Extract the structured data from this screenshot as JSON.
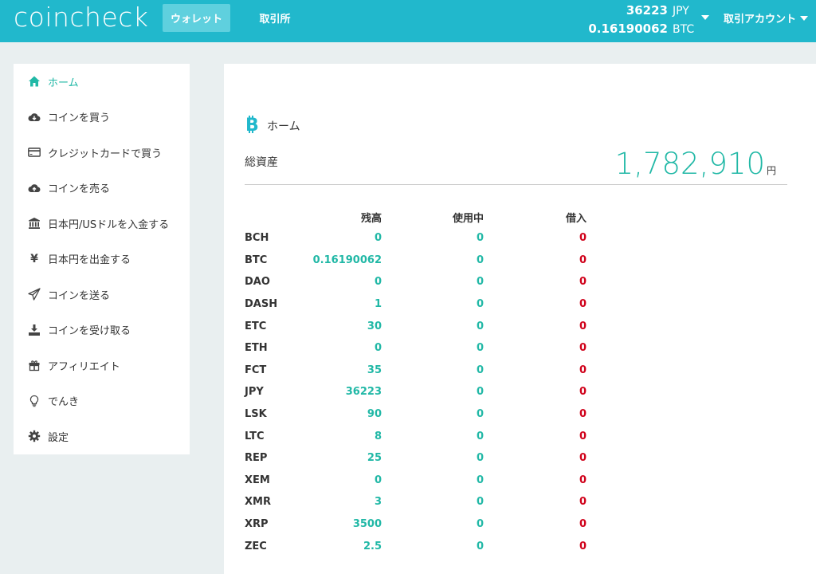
{
  "header": {
    "logo": "coincheck",
    "nav": {
      "wallet": "ウォレット",
      "exchange": "取引所"
    },
    "balance": {
      "jpy_amount": "36223",
      "jpy_unit": "JPY",
      "btc_amount": "0.16190062",
      "btc_unit": "BTC"
    },
    "account": "取引アカウント"
  },
  "sidebar": {
    "items": [
      {
        "label": "ホーム",
        "icon": "home-icon"
      },
      {
        "label": "コインを買う",
        "icon": "cloud-download-icon"
      },
      {
        "label": "クレジットカードで買う",
        "icon": "credit-card-icon"
      },
      {
        "label": "コインを売る",
        "icon": "cloud-upload-icon"
      },
      {
        "label": "日本円/USドルを入金する",
        "icon": "bank-icon"
      },
      {
        "label": "日本円を出金する",
        "icon": "yen-icon"
      },
      {
        "label": "コインを送る",
        "icon": "send-icon"
      },
      {
        "label": "コインを受け取る",
        "icon": "download-icon"
      },
      {
        "label": "アフィリエイト",
        "icon": "gift-icon"
      },
      {
        "label": "でんき",
        "icon": "lightbulb-icon"
      },
      {
        "label": "設定",
        "icon": "gear-icon"
      }
    ]
  },
  "main": {
    "title": "ホーム",
    "total_label": "総資産",
    "total_value": "1,782,910",
    "total_unit": "円",
    "table": {
      "headers": {
        "balance": "残高",
        "in_use": "使用中",
        "borrowed": "借入"
      },
      "rows": [
        {
          "coin": "BCH",
          "balance": "0",
          "in_use": "0",
          "borrowed": "0"
        },
        {
          "coin": "BTC",
          "balance": "0.16190062",
          "in_use": "0",
          "borrowed": "0"
        },
        {
          "coin": "DAO",
          "balance": "0",
          "in_use": "0",
          "borrowed": "0"
        },
        {
          "coin": "DASH",
          "balance": "1",
          "in_use": "0",
          "borrowed": "0"
        },
        {
          "coin": "ETC",
          "balance": "30",
          "in_use": "0",
          "borrowed": "0"
        },
        {
          "coin": "ETH",
          "balance": "0",
          "in_use": "0",
          "borrowed": "0"
        },
        {
          "coin": "FCT",
          "balance": "35",
          "in_use": "0",
          "borrowed": "0"
        },
        {
          "coin": "JPY",
          "balance": "36223",
          "in_use": "0",
          "borrowed": "0"
        },
        {
          "coin": "LSK",
          "balance": "90",
          "in_use": "0",
          "borrowed": "0"
        },
        {
          "coin": "LTC",
          "balance": "8",
          "in_use": "0",
          "borrowed": "0"
        },
        {
          "coin": "REP",
          "balance": "25",
          "in_use": "0",
          "borrowed": "0"
        },
        {
          "coin": "XEM",
          "balance": "0",
          "in_use": "0",
          "borrowed": "0"
        },
        {
          "coin": "XMR",
          "balance": "3",
          "in_use": "0",
          "borrowed": "0"
        },
        {
          "coin": "XRP",
          "balance": "3500",
          "in_use": "0",
          "borrowed": "0"
        },
        {
          "coin": "ZEC",
          "balance": "2.5",
          "in_use": "0",
          "borrowed": "0"
        }
      ]
    }
  },
  "colors": {
    "brand": "#21b8cc",
    "positive": "#21b8a6",
    "negative": "#d0021b"
  }
}
